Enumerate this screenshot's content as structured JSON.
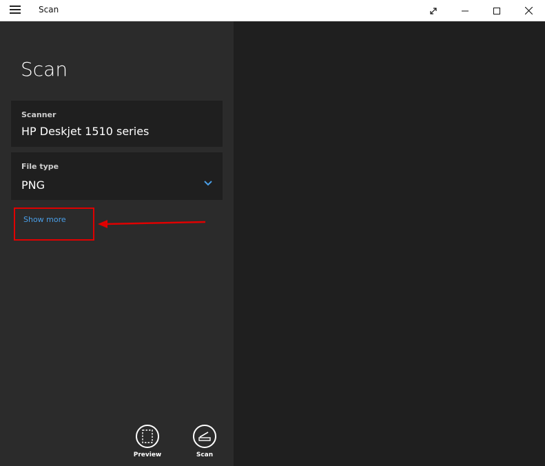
{
  "window": {
    "title": "Scan",
    "controls": [
      "restore-arrows-icon",
      "minimize-icon",
      "maximize-icon",
      "close-icon"
    ]
  },
  "page": {
    "title": "Scan"
  },
  "scanner": {
    "label": "Scanner",
    "value": "HP Deskjet 1510 series"
  },
  "file_type": {
    "label": "File type",
    "value": "PNG",
    "icon": "chevron-down-icon"
  },
  "show_more": {
    "label": "Show more"
  },
  "actions": {
    "preview_label": "Preview",
    "scan_label": "Scan"
  },
  "colors": {
    "accent": "#4a9fe8",
    "annotation": "#e00000",
    "pane_left": "#2b2b2b",
    "pane_right": "#1f1f1f"
  }
}
